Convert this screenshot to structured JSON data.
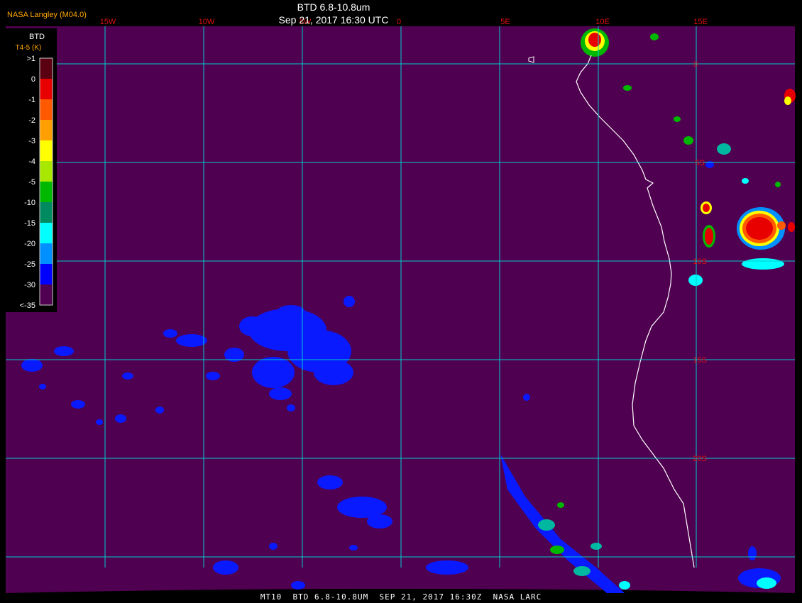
{
  "header": {
    "source": "NASA Langley (M04.0)",
    "title": "BTD 6.8-10.8um",
    "datetime": "Sep 21, 2017 16:30 UTC"
  },
  "footer": {
    "caption": "MT10  BTD 6.8-10.8UM  SEP 21, 2017 16:30Z  NASA LARC"
  },
  "grid": {
    "longitude_labels": [
      "15W",
      "10W",
      "5W",
      "0",
      "5E",
      "10E",
      "15E"
    ],
    "latitude_labels": [
      "0",
      "5S",
      "10S",
      "15S",
      "20S"
    ]
  },
  "legend": {
    "title": "BTD",
    "subtitle": "T4-5 (K)",
    "labels": [
      ">1",
      "0",
      "-1",
      "-2",
      "-3",
      "-4",
      "-5",
      "-10",
      "-15",
      "-20",
      "-25",
      "-30",
      "<-35"
    ],
    "colors": [
      "#5a0010",
      "#e80000",
      "#ff5a00",
      "#ffa000",
      "#ffff00",
      "#a8e800",
      "#00b800",
      "#008a60",
      "#00ffff",
      "#0090ff",
      "#0000ff",
      "#500050"
    ]
  },
  "colors": {
    "background": "#500050",
    "grid": "#00cccc",
    "coastline": "#ffffff",
    "cloud_low": "#0a1aff"
  }
}
